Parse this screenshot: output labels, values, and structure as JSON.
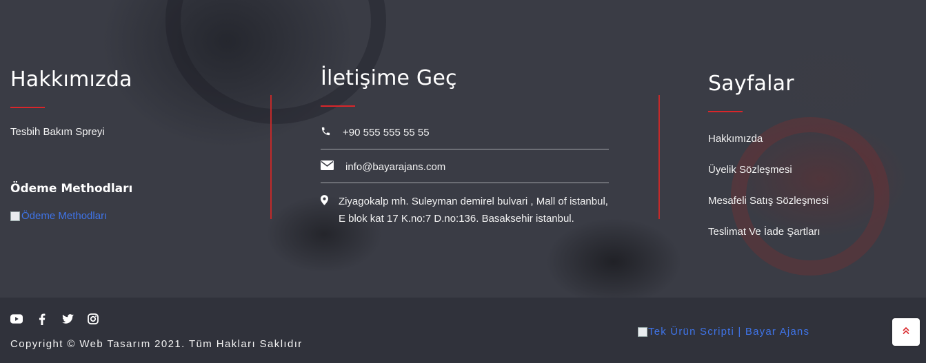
{
  "about": {
    "title": "Hakkımızda",
    "text": "Tesbih Bakım Spreyi",
    "payment_title": "Ödeme Methodları",
    "payment_image_alt": "Ödeme Methodları"
  },
  "contact": {
    "title": "İletişime Geç",
    "phone": "+90 555 555 55 55",
    "email": "info@bayarajans.com",
    "address": "Ziyagokalp mh. Suleyman demirel bulvari , Mall of istanbul, E blok kat 17 K.no:7 D.no:136. Basaksehir istanbul."
  },
  "pages": {
    "title": "Sayfalar",
    "items": [
      {
        "label": "Hakkımızda"
      },
      {
        "label": "Üyelik Sözleşmesi"
      },
      {
        "label": "Mesafeli Satış Sözleşmesi"
      },
      {
        "label": "Teslimat Ve İade Şartları"
      }
    ]
  },
  "bottom": {
    "social": [
      "youtube-icon",
      "facebook-icon",
      "twitter-icon",
      "instagram-icon"
    ],
    "copyright": "Copyright © Web Tasarım 2021. Tüm Hakları Saklıdır",
    "brand_image_alt": "Tek Ürün Scripti | Bayar Ajans"
  },
  "colors": {
    "accent_red": "#d9262a",
    "link_blue": "#3f74e8",
    "bottom_bg": "#30323b"
  }
}
